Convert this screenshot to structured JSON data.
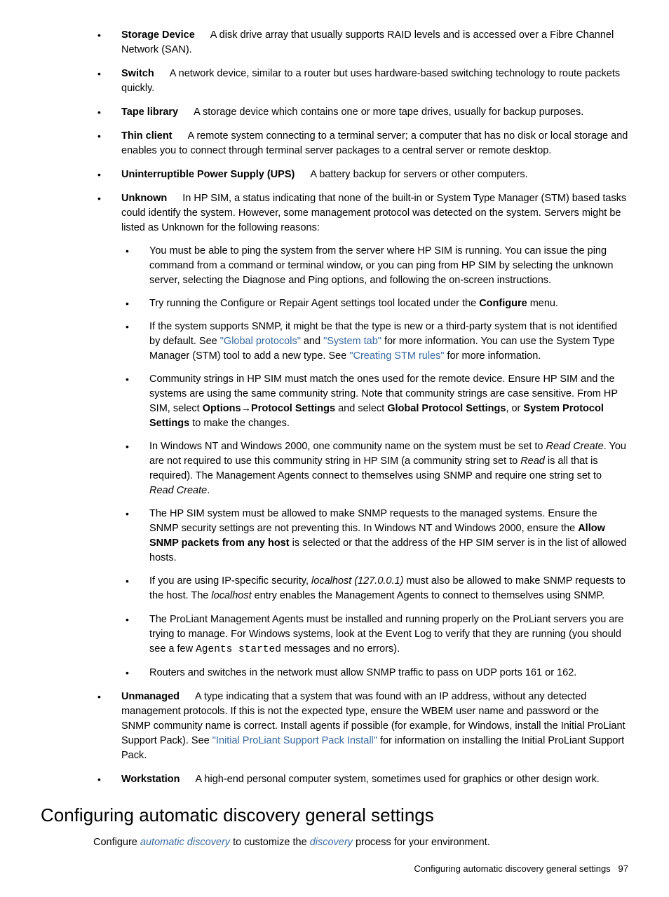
{
  "items": [
    {
      "term": "Storage Device",
      "body": "A disk drive array that usually supports RAID levels and is accessed over a Fibre Channel Network (SAN)."
    },
    {
      "term": "Switch",
      "body": "A network device, similar to a router but uses hardware-based switching technology to route packets quickly."
    },
    {
      "term": "Tape library",
      "body": "A storage device which contains one or more tape drives, usually for backup purposes."
    },
    {
      "term": "Thin client",
      "body": "A remote system connecting to a terminal server; a computer that has no disk or local storage and enables you to connect through terminal server packages to a central server or remote desktop."
    },
    {
      "term": "Uninterruptible Power Supply (UPS)",
      "body": "A battery backup for servers or other computers."
    }
  ],
  "unknown": {
    "term": "Unknown",
    "body": "In HP SIM, a status indicating that none of the built-in or System Type Manager (STM) based tasks could identify the system. However, some management protocol was detected on the system. Servers might be listed as Unknown for the following reasons:",
    "sub1": "You must be able to ping the system from the server where HP SIM is running. You can issue the ping command from a command or terminal window, or you can ping from HP SIM by selecting the unknown server, selecting the Diagnose and Ping options, and following the on-screen instructions.",
    "sub2a": "Try running the Configure or Repair Agent settings tool located under the ",
    "sub2b": "Configure",
    "sub2c": " menu.",
    "sub3a": "If the system supports SNMP, it might be that the type is new or a third-party system that is not identified by default. See ",
    "sub3link1": "\"Global protocols\"",
    "sub3b": " and ",
    "sub3link2": "\"System tab\"",
    "sub3c": " for more information. You can use the System Type Manager (STM) tool to add a new type. See ",
    "sub3link3": "\"Creating STM rules\"",
    "sub3d": " for more information.",
    "sub4a": "Community strings in HP SIM must match the ones used for the remote device. Ensure HP SIM and the systems are using the same community string. Note that community strings are case sensitive. From HP SIM, select ",
    "sub4b": "Options",
    "sub4arrow": "→",
    "sub4c": "Protocol Settings",
    "sub4d": " and select ",
    "sub4e": "Global Protocol Settings",
    "sub4f": ", or ",
    "sub4g": "System Protocol Settings",
    "sub4h": " to make the changes.",
    "sub5a": "In Windows NT and Windows 2000, one community name on the system must be set to ",
    "sub5i1": "Read Create",
    "sub5b": ". You are not required to use this community string in HP SIM (a community string set to ",
    "sub5i2": "Read",
    "sub5c": " is all that is required). The Management Agents connect to themselves using SNMP and require one string set to ",
    "sub5i3": "Read Create",
    "sub5d": ".",
    "sub6a": "The HP SIM system must be allowed to make SNMP requests to the managed systems. Ensure the SNMP security settings are not preventing this. In Windows NT and Windows 2000, ensure the ",
    "sub6b": "Allow SNMP packets from any host",
    "sub6c": " is selected or that the address of the HP SIM server is in the list of allowed hosts.",
    "sub7a": "If you are using IP-specific security, ",
    "sub7i1": "localhost (127.0.0.1)",
    "sub7b": " must also be allowed to make SNMP requests to the host. The ",
    "sub7i2": "localhost",
    "sub7c": " entry enables the Management Agents to connect to themselves using SNMP.",
    "sub8a": "The ProLiant Management Agents must be installed and running properly on the ProLiant servers you are trying to manage. For Windows systems, look at the Event Log to verify that they are running (you should see a few ",
    "sub8m": "Agents started",
    "sub8b": " messages and no errors).",
    "sub9": "Routers and switches in the network must allow SNMP traffic to pass on UDP ports 161 or 162."
  },
  "unmanaged": {
    "term": "Unmanaged",
    "a": "A type indicating that a system that was found with an IP address, without any detected management protocols. If this is not the expected type, ensure the WBEM user name and password or the SNMP community name is correct. Install agents if possible (for example, for Windows, install the Initial ProLiant Support Pack). See ",
    "link": "\"Initial ProLiant Support Pack Install\"",
    "b": " for information on installing the Initial ProLiant Support Pack."
  },
  "workstation": {
    "term": "Workstation",
    "body": "A high-end personal computer system, sometimes used for graphics or other design work."
  },
  "heading": "Configuring automatic discovery general settings",
  "para": {
    "a": "Configure ",
    "l1": "automatic discovery",
    "b": " to customize the ",
    "l2": "discovery",
    "c": " process for your environment."
  },
  "footer": {
    "text": "Configuring automatic discovery general settings",
    "page": "97"
  }
}
